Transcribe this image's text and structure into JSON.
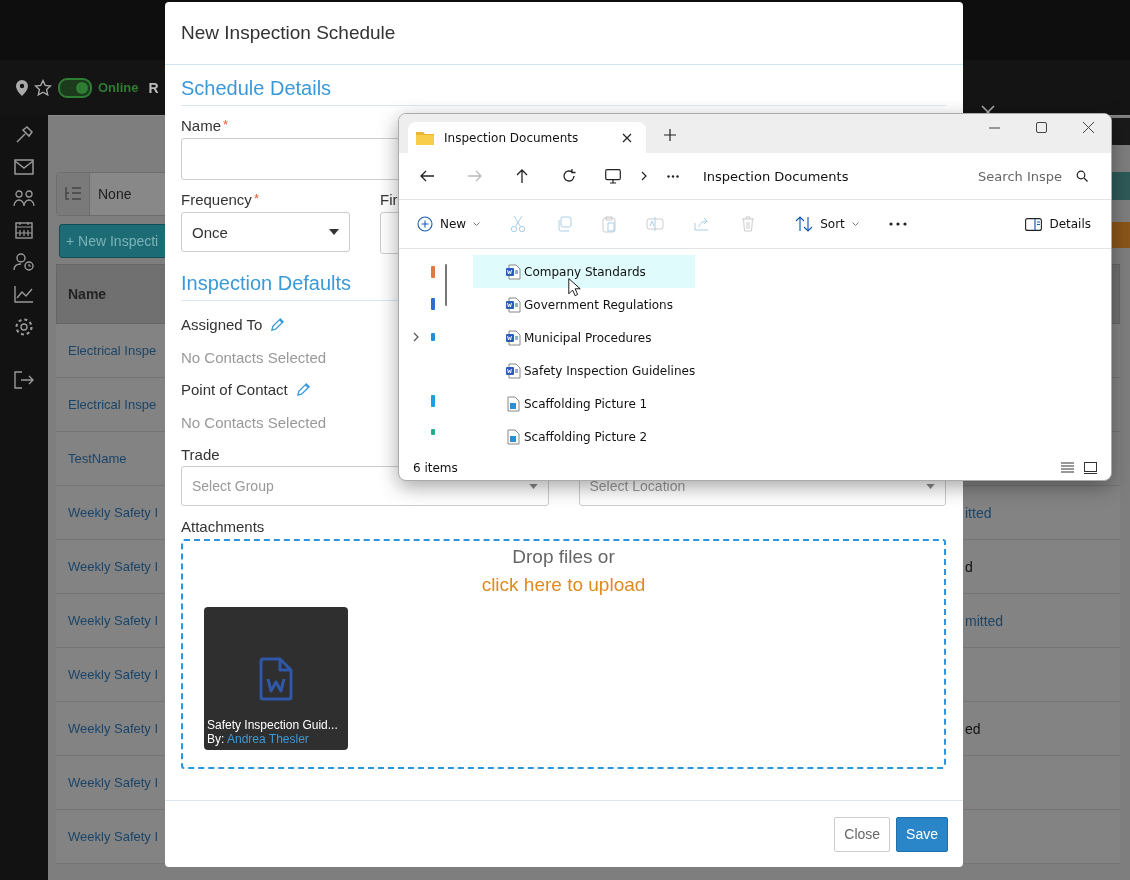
{
  "app": {
    "status_label": "Online",
    "online": true,
    "header_fragment": "R",
    "filter": {
      "value": "None"
    },
    "new_button": "+ New Inspecti",
    "table": {
      "columns": [
        "Name"
      ],
      "rows": [
        {
          "name": "Electrical Inspe"
        },
        {
          "name": "Electrical Inspe"
        },
        {
          "name": "TestName"
        },
        {
          "name": "Weekly Safety I",
          "column_2": "itted",
          "kind": "link"
        },
        {
          "name": "Weekly Safety I",
          "column_2": "d",
          "kind": "text"
        },
        {
          "name": "Weekly Safety I",
          "column_2": "mitted",
          "kind": "link"
        },
        {
          "name": "Weekly Safety I"
        },
        {
          "name": "Weekly Safety I",
          "column_2": "ed",
          "kind": "text"
        },
        {
          "name": "Weekly Safety I"
        },
        {
          "name": "Weekly Safety I"
        }
      ]
    }
  },
  "modal": {
    "title": "New Inspection Schedule",
    "section_1": "Schedule Details",
    "required_mark": "*",
    "name_field": {
      "label": "Name",
      "required": true
    },
    "frequency_field": {
      "label": "Frequency",
      "required": true,
      "value": "Once"
    },
    "second_field_label": "Fir",
    "section_2": "Inspection Defaults",
    "assigned_to": {
      "label": "Assigned To",
      "value": "No Contacts Selected"
    },
    "point_of_contact": {
      "label": "Point of Contact",
      "value": "No Contacts Selected"
    },
    "trade": {
      "label": "Trade",
      "group_placeholder": "Select Group",
      "location_placeholder": "Select Location"
    },
    "attachments": {
      "label": "Attachments",
      "drop_text": "Drop files or",
      "upload_link": "click here to upload",
      "files": [
        {
          "name": "Safety Inspection Guid...",
          "by_label": "By:",
          "author": "Andrea Thesler"
        }
      ]
    },
    "buttons": {
      "close": "Close",
      "save": "Save"
    }
  },
  "explorer": {
    "tab": "Inspection Documents",
    "breadcrumb": "Inspection Documents",
    "search": {
      "placeholder": "Search Inspe"
    },
    "toolbar": {
      "new": "New",
      "sort": "Sort",
      "details": "Details"
    },
    "files": [
      {
        "name": "Company Standards",
        "kind": "word",
        "selected": true
      },
      {
        "name": "Government Regulations",
        "kind": "word",
        "selected": false
      },
      {
        "name": "Municipal Procedures",
        "kind": "word",
        "selected": false
      },
      {
        "name": "Safety Inspection Guidelines",
        "kind": "word",
        "selected": false
      },
      {
        "name": "Scaffolding Picture 1",
        "kind": "image",
        "selected": false
      },
      {
        "name": "Scaffolding Picture 2",
        "kind": "image",
        "selected": false
      }
    ],
    "status": "6 items"
  }
}
